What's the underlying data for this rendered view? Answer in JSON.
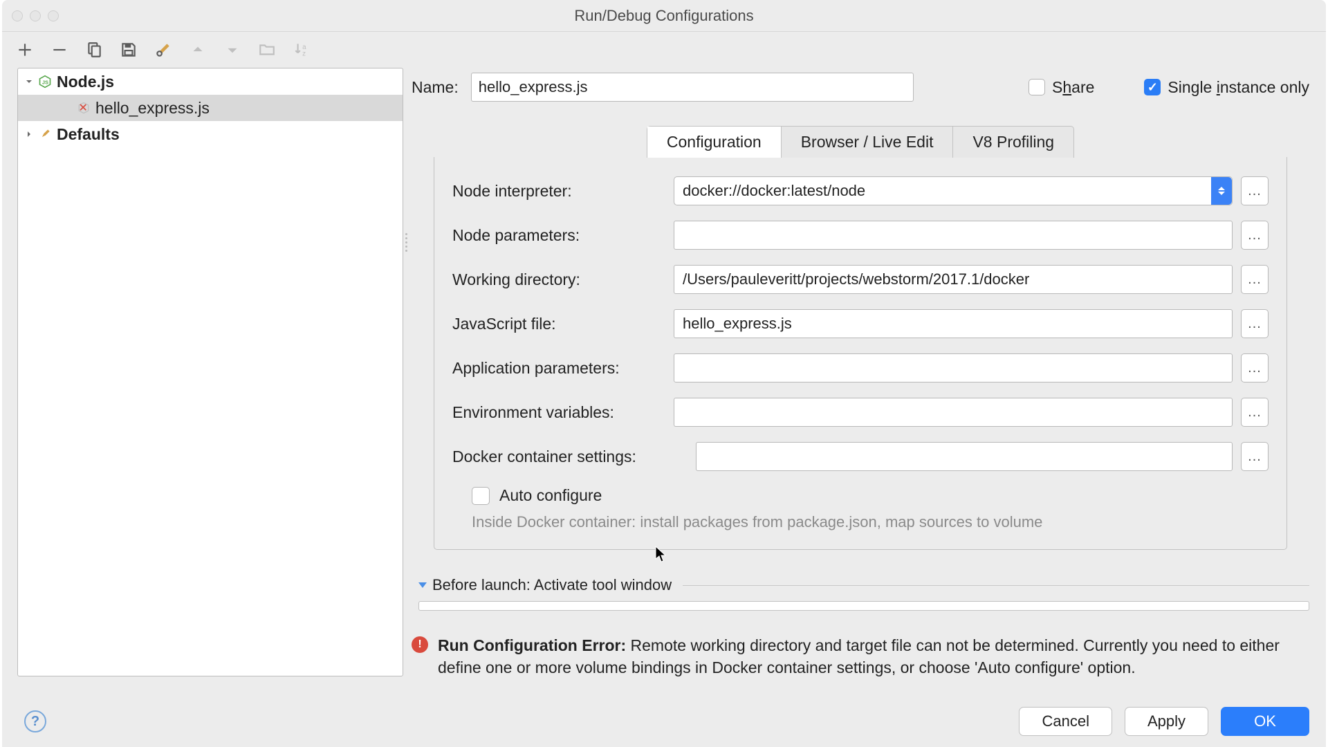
{
  "window": {
    "title": "Run/Debug Configurations"
  },
  "toolbar": {
    "add": "add",
    "remove": "remove",
    "copy": "copy",
    "save": "save",
    "edit_defaults": "wrench",
    "up": "up",
    "down": "down",
    "folder": "folder",
    "sort": "sort"
  },
  "tree": {
    "nodejs": {
      "label": "Node.js"
    },
    "config_item": {
      "label": "hello_express.js"
    },
    "defaults": {
      "label": "Defaults"
    }
  },
  "name": {
    "label": "Name:",
    "value": "hello_express.js"
  },
  "share": {
    "label_pre": "S",
    "label_u": "h",
    "label_post": "are"
  },
  "single_instance": {
    "label_pre": "Single ",
    "label_u": "i",
    "label_post": "nstance only"
  },
  "tabs": {
    "configuration": "Configuration",
    "browser": "Browser / Live Edit",
    "v8": "V8 Profiling"
  },
  "form": {
    "node_interpreter": {
      "label": "Node interpreter:",
      "value": "docker://docker:latest/node"
    },
    "node_parameters": {
      "label": "Node parameters:",
      "value": ""
    },
    "working_directory": {
      "label": "Working directory:",
      "value": "/Users/pauleveritt/projects/webstorm/2017.1/docker"
    },
    "javascript_file": {
      "label": "JavaScript file:",
      "value": "hello_express.js"
    },
    "application_parameters": {
      "label": "Application parameters:",
      "value": ""
    },
    "environment_variables": {
      "label": "Environment variables:",
      "value": ""
    },
    "docker_container_settings": {
      "label": "Docker container settings:",
      "value": ""
    },
    "auto_configure": {
      "label": "Auto configure"
    },
    "hint": "Inside Docker container: install packages from package.json, map sources to volume"
  },
  "before_launch": {
    "label": "Before launch: Activate tool window"
  },
  "error": {
    "title": "Run Configuration Error:",
    "msg": " Remote working directory and target file can not be determined. Currently you need to either define one or more volume bindings in Docker container settings, or choose 'Auto configure' option."
  },
  "buttons": {
    "cancel": "Cancel",
    "apply": "Apply",
    "ok": "OK"
  },
  "browse": "..."
}
